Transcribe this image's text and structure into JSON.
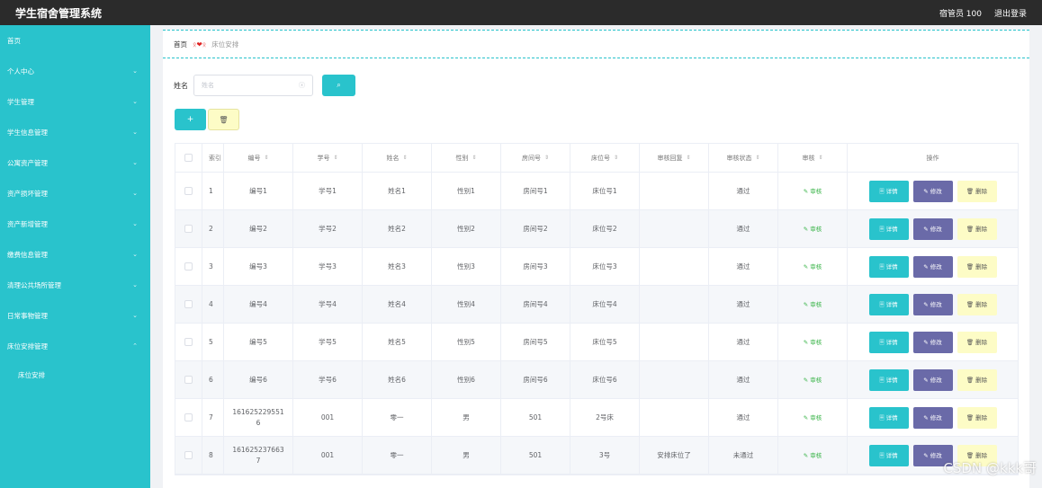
{
  "topbar": {
    "title": "学生宿舍管理系统",
    "user": "宿管员 100",
    "logout": "退出登录"
  },
  "sidebar": {
    "items": [
      {
        "label": "首页",
        "chevron": ""
      },
      {
        "label": "个人中心",
        "chevron": "⌄"
      },
      {
        "label": "学生管理",
        "chevron": "⌄"
      },
      {
        "label": "学生信息管理",
        "chevron": "⌄"
      },
      {
        "label": "公寓资产管理",
        "chevron": "⌄"
      },
      {
        "label": "资产损坏管理",
        "chevron": "⌄"
      },
      {
        "label": "资产新增管理",
        "chevron": "⌄"
      },
      {
        "label": "缴费信息管理",
        "chevron": "⌄"
      },
      {
        "label": "清理公共场所管理",
        "chevron": "⌄"
      },
      {
        "label": "日常事物管理",
        "chevron": "⌄"
      },
      {
        "label": "床位安排管理",
        "chevron": "⌃"
      }
    ],
    "sub_item": "床位安排"
  },
  "breadcrumb": {
    "home": "首页",
    "sep_left": "ᛟ",
    "heart": "❤",
    "sep_right": "ᛟ",
    "current": "床位安排"
  },
  "search": {
    "label": "姓名",
    "placeholder": "姓名",
    "clear_icon": "ⓧ",
    "button_icon": "⌕"
  },
  "actions": {
    "add": "+",
    "delete": "🗑"
  },
  "table": {
    "headers": [
      "索引",
      "编号",
      "学号",
      "姓名",
      "性别",
      "房间号",
      "床位号",
      "审核回复",
      "审核状态",
      "审核",
      "操作"
    ],
    "sort_icon": "⇕",
    "audit_label": "✎ 审核",
    "op_detail": "🗏 详情",
    "op_edit": "✎ 修改",
    "op_remove": "🗑 删除",
    "rows": [
      [
        "1",
        "编号1",
        "学号1",
        "姓名1",
        "性别1",
        "房间号1",
        "床位号1",
        "",
        "通过"
      ],
      [
        "2",
        "编号2",
        "学号2",
        "姓名2",
        "性别2",
        "房间号2",
        "床位号2",
        "",
        "通过"
      ],
      [
        "3",
        "编号3",
        "学号3",
        "姓名3",
        "性别3",
        "房间号3",
        "床位号3",
        "",
        "通过"
      ],
      [
        "4",
        "编号4",
        "学号4",
        "姓名4",
        "性别4",
        "房间号4",
        "床位号4",
        "",
        "通过"
      ],
      [
        "5",
        "编号5",
        "学号5",
        "姓名5",
        "性别5",
        "房间号5",
        "床位号5",
        "",
        "通过"
      ],
      [
        "6",
        "编号6",
        "学号6",
        "姓名6",
        "性别6",
        "房间号6",
        "床位号6",
        "",
        "通过"
      ],
      [
        "7",
        "1616252295516",
        "001",
        "零一",
        "男",
        "501",
        "2号床",
        "",
        "通过"
      ],
      [
        "8",
        "1616252376637",
        "001",
        "零一",
        "男",
        "501",
        "3号",
        "安排床位了",
        "未通过"
      ]
    ]
  },
  "watermark": "CSDN @kkk哥",
  "colors": {
    "accent": "#29c3cc",
    "topbar": "#2b2b2b",
    "edit": "#6a6aa8",
    "remove": "#fdfcc6",
    "audit": "#3bb54a"
  }
}
